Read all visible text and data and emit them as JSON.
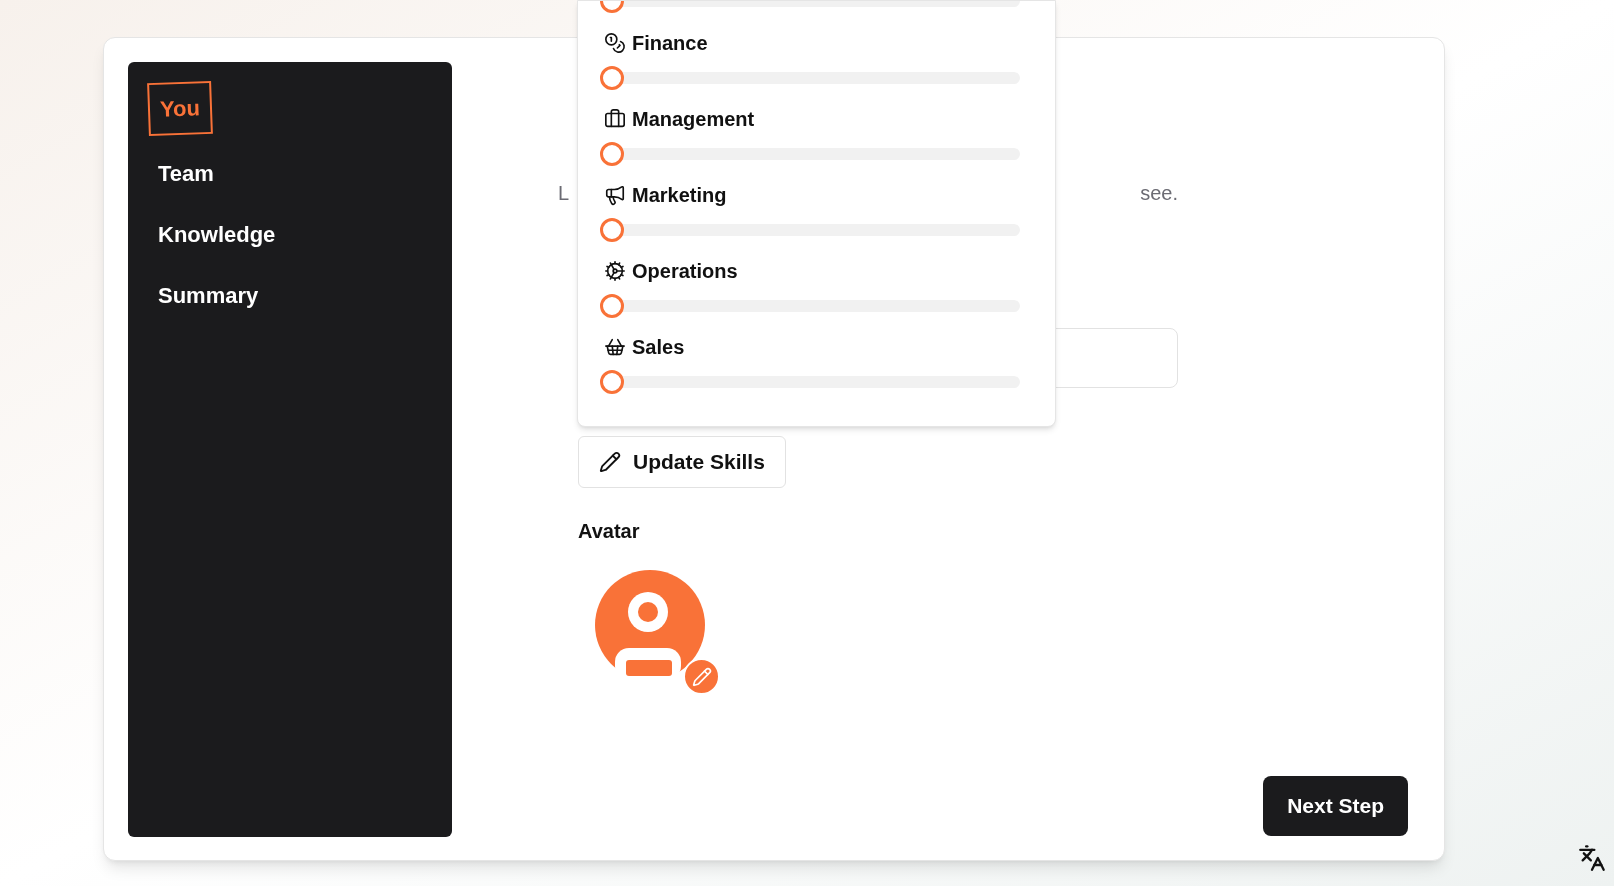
{
  "sidebar": {
    "items": [
      {
        "label": "You",
        "selected": true
      },
      {
        "label": "Team",
        "selected": false
      },
      {
        "label": "Knowledge",
        "selected": false
      },
      {
        "label": "Summary",
        "selected": false
      }
    ]
  },
  "subtitle_fragments": [
    "L",
    "see."
  ],
  "skills_popup": {
    "partial_slider": {
      "level": 0
    },
    "skills": [
      {
        "kind": "finance",
        "label": "Finance",
        "level": 0
      },
      {
        "kind": "management",
        "label": "Management",
        "level": 0
      },
      {
        "kind": "marketing",
        "label": "Marketing",
        "level": 0
      },
      {
        "kind": "operations",
        "label": "Operations",
        "level": 0
      },
      {
        "kind": "sales",
        "label": "Sales",
        "level": 0
      }
    ]
  },
  "update_button": "Update Skills",
  "avatar_label": "Avatar",
  "next_button": "Next Step"
}
